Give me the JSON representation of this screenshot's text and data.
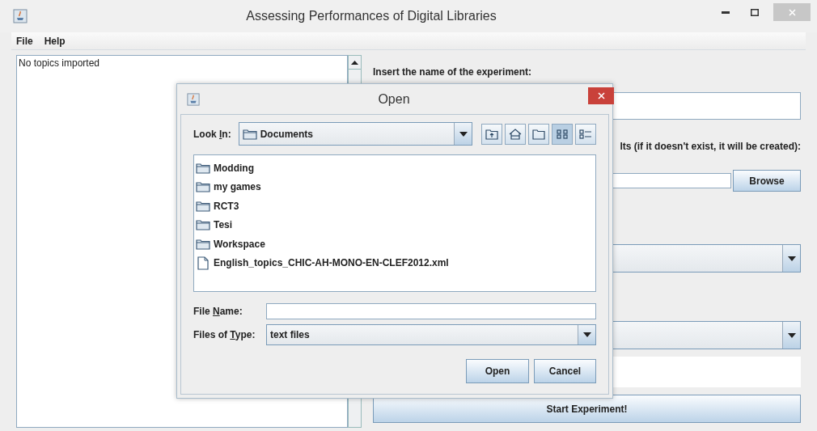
{
  "window": {
    "title": "Assessing Performances of Digital Libraries"
  },
  "menu": [
    "File",
    "Help"
  ],
  "topics_list": {
    "text": "No topics imported"
  },
  "form": {
    "name_label": "Insert the name of the experiment:",
    "results_label": "lts (if it doesn't exist, it will be created):",
    "browse_button": "Browse",
    "start_button": "Start Experiment!"
  },
  "dialog": {
    "title": "Open",
    "look_in": {
      "label_parts": [
        "Look ",
        "I",
        "n:"
      ],
      "value": "Documents"
    },
    "toolbar": [
      {
        "kind": "up",
        "selected": false
      },
      {
        "kind": "home",
        "selected": false
      },
      {
        "kind": "new-folder",
        "selected": false
      },
      {
        "kind": "list",
        "selected": true
      },
      {
        "kind": "details",
        "selected": false
      }
    ],
    "files": [
      {
        "name": "Modding",
        "kind": "folder"
      },
      {
        "name": "my games",
        "kind": "folder"
      },
      {
        "name": "RCT3",
        "kind": "folder"
      },
      {
        "name": "Tesi",
        "kind": "folder"
      },
      {
        "name": "Workspace",
        "kind": "folder"
      },
      {
        "name": "English_topics_CHIC-AH-MONO-EN-CLEF2012.xml",
        "kind": "file"
      }
    ],
    "file_name": {
      "label_parts": [
        "File ",
        "N",
        "ame:"
      ]
    },
    "file_type": {
      "label_parts": [
        "Files of ",
        "T",
        "ype:"
      ],
      "value": "text files"
    },
    "buttons": [
      "Open",
      "Cancel"
    ]
  }
}
